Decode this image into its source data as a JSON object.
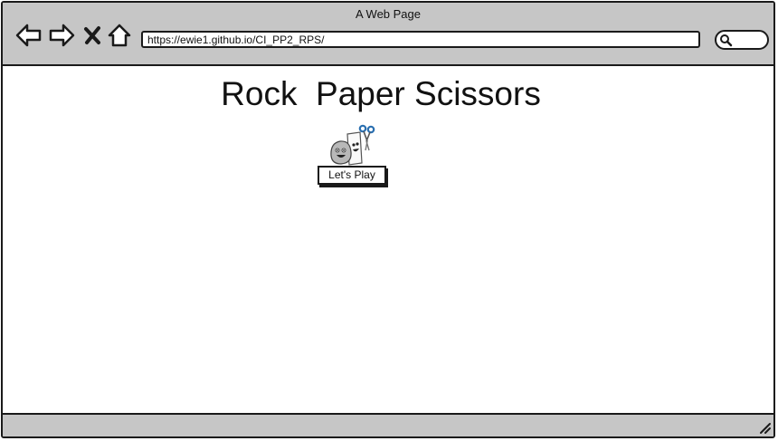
{
  "window": {
    "title": "A Web Page"
  },
  "toolbar": {
    "back_icon": "back-arrow-icon",
    "forward_icon": "forward-arrow-icon",
    "close_icon": "close-x-icon",
    "home_icon": "home-icon",
    "url": "https://ewie1.github.io/CI_PP2_RPS/",
    "search_icon": "search-icon"
  },
  "page": {
    "title": "Rock  Paper Scissors",
    "hero_image": "rock-paper-scissors-characters",
    "play_button_label": "Let's Play"
  },
  "colors": {
    "chrome": "#c6c6c6",
    "border": "#1a1a1a",
    "background": "#ffffff",
    "scissors_blue": "#2a6fb0"
  }
}
